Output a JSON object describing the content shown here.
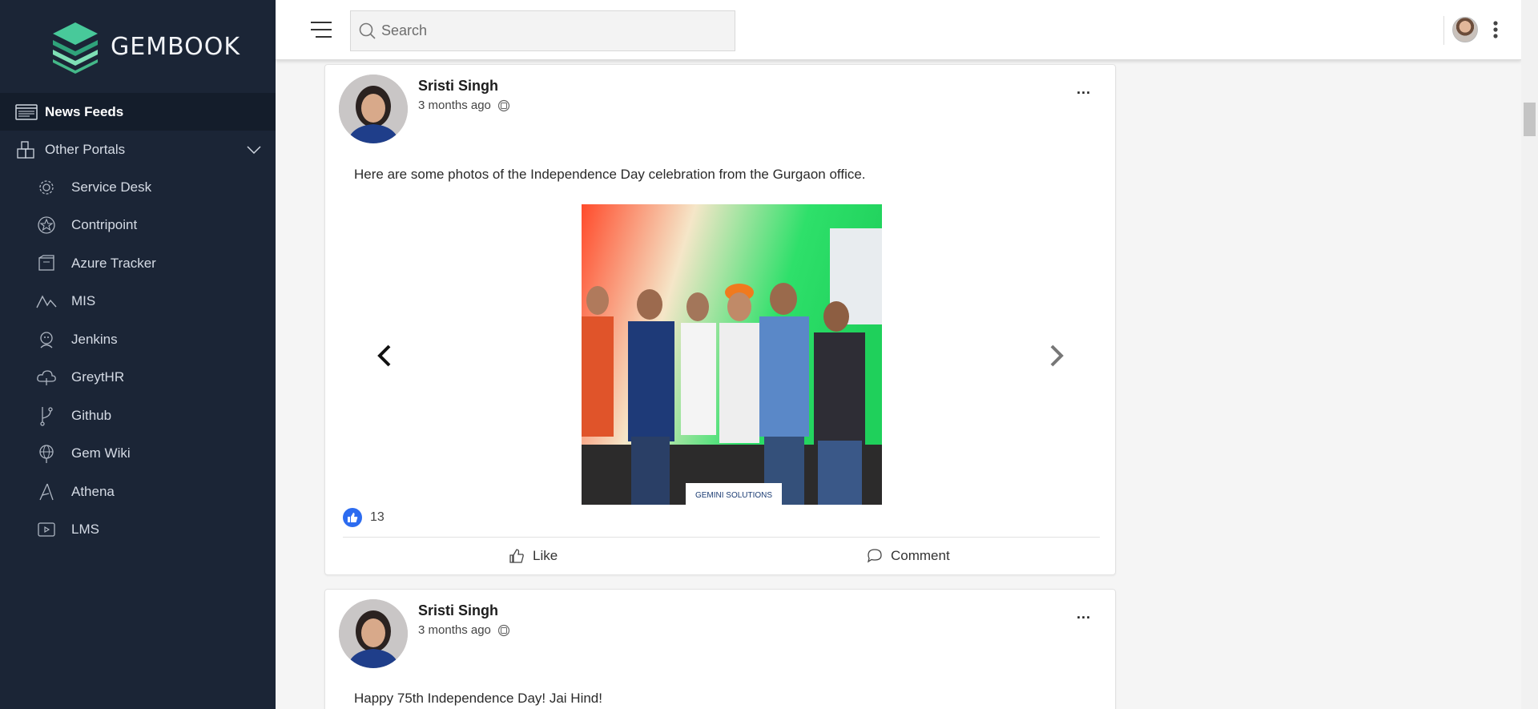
{
  "brand": {
    "name": "GEMBOOK"
  },
  "sidebar": {
    "primary": [
      {
        "label": "News Feeds",
        "icon": "news-feed-icon",
        "active": true
      },
      {
        "label": "Other Portals",
        "icon": "portals-icon",
        "expanded": true
      }
    ],
    "portals": [
      {
        "label": "Service Desk",
        "icon": "gear-icon"
      },
      {
        "label": "Contripoint",
        "icon": "star-badge-icon"
      },
      {
        "label": "Azure Tracker",
        "icon": "tracker-icon"
      },
      {
        "label": "MIS",
        "icon": "chart-line-icon"
      },
      {
        "label": "Jenkins",
        "icon": "jenkins-icon"
      },
      {
        "label": "GreytHR",
        "icon": "cloud-icon"
      },
      {
        "label": "Github",
        "icon": "branch-icon"
      },
      {
        "label": "Gem Wiki",
        "icon": "globe-icon"
      },
      {
        "label": "Athena",
        "icon": "triangle-icon"
      },
      {
        "label": "LMS",
        "icon": "video-icon"
      }
    ]
  },
  "topbar": {
    "search_placeholder": "Search"
  },
  "posts": [
    {
      "author": "Sristi Singh",
      "time": "3 months ago",
      "text": "Here are some photos of the Independence Day celebration from the Gurgaon office.",
      "like_count": "13",
      "actions": {
        "like": "Like",
        "comment": "Comment"
      },
      "more": "..."
    },
    {
      "author": "Sristi Singh",
      "time": "3 months ago",
      "text": "Happy 75th Independence Day! Jai Hind!",
      "more": "..."
    }
  ],
  "photo_watermark": "GEMINI SOLUTIONS",
  "colors": {
    "sidebar_bg": "#1b2536",
    "accent_green": "#3dbf8a",
    "like_blue": "#2d6cf0"
  }
}
